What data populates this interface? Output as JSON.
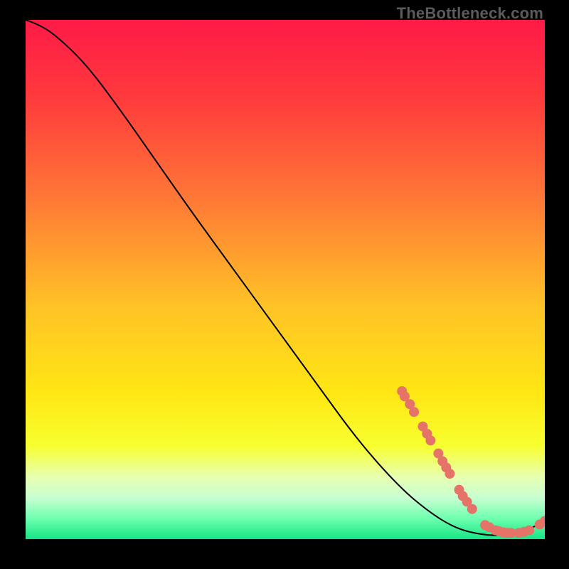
{
  "watermark": "TheBottleneck.com",
  "chart_data": {
    "type": "line",
    "title": "",
    "xlabel": "",
    "ylabel": "",
    "xlim": [
      0,
      100
    ],
    "ylim": [
      0,
      100
    ],
    "grid": false,
    "legend": false,
    "gradient_stops": [
      {
        "offset": 0.0,
        "color": "#ff1a47"
      },
      {
        "offset": 0.15,
        "color": "#ff3a3d"
      },
      {
        "offset": 0.35,
        "color": "#ff7a36"
      },
      {
        "offset": 0.55,
        "color": "#ffc226"
      },
      {
        "offset": 0.72,
        "color": "#ffe714"
      },
      {
        "offset": 0.82,
        "color": "#f7ff2f"
      },
      {
        "offset": 0.88,
        "color": "#e8ffb0"
      },
      {
        "offset": 0.92,
        "color": "#c8ffd2"
      },
      {
        "offset": 0.96,
        "color": "#6effaf"
      },
      {
        "offset": 1.0,
        "color": "#16e585"
      }
    ],
    "series": [
      {
        "name": "bottleneck-curve",
        "stroke": "#000000",
        "points": [
          {
            "x": 0,
            "y": 100
          },
          {
            "x": 3,
            "y": 99
          },
          {
            "x": 7,
            "y": 96
          },
          {
            "x": 12,
            "y": 91
          },
          {
            "x": 18,
            "y": 83
          },
          {
            "x": 25,
            "y": 73
          },
          {
            "x": 32,
            "y": 63
          },
          {
            "x": 40,
            "y": 52
          },
          {
            "x": 48,
            "y": 41
          },
          {
            "x": 56,
            "y": 30
          },
          {
            "x": 64,
            "y": 19
          },
          {
            "x": 72,
            "y": 10
          },
          {
            "x": 78,
            "y": 5
          },
          {
            "x": 83,
            "y": 2
          },
          {
            "x": 88,
            "y": 0.8
          },
          {
            "x": 92,
            "y": 0.7
          },
          {
            "x": 96,
            "y": 1.4
          },
          {
            "x": 100,
            "y": 3.5
          }
        ]
      }
    ],
    "marker_points": {
      "color": "#e57368",
      "radius_screen_px": 7,
      "points": [
        {
          "x": 72.5,
          "y": 28.5
        },
        {
          "x": 73.0,
          "y": 27.5
        },
        {
          "x": 74.0,
          "y": 26.0
        },
        {
          "x": 74.8,
          "y": 24.5
        },
        {
          "x": 76.5,
          "y": 21.7
        },
        {
          "x": 77.3,
          "y": 20.3
        },
        {
          "x": 78.0,
          "y": 19.0
        },
        {
          "x": 79.5,
          "y": 16.5
        },
        {
          "x": 80.3,
          "y": 15.0
        },
        {
          "x": 81.0,
          "y": 13.8
        },
        {
          "x": 81.7,
          "y": 12.6
        },
        {
          "x": 83.5,
          "y": 9.5
        },
        {
          "x": 84.2,
          "y": 8.3
        },
        {
          "x": 85.0,
          "y": 7.2
        },
        {
          "x": 86.0,
          "y": 5.8
        },
        {
          "x": 88.5,
          "y": 2.7
        },
        {
          "x": 89.3,
          "y": 2.3
        },
        {
          "x": 90.5,
          "y": 1.7
        },
        {
          "x": 91.2,
          "y": 1.5
        },
        {
          "x": 92.0,
          "y": 1.3
        },
        {
          "x": 92.8,
          "y": 1.2
        },
        {
          "x": 93.5,
          "y": 1.2
        },
        {
          "x": 95.0,
          "y": 1.2
        },
        {
          "x": 96.0,
          "y": 1.4
        },
        {
          "x": 97.0,
          "y": 1.7
        },
        {
          "x": 99.0,
          "y": 2.8
        },
        {
          "x": 100.0,
          "y": 3.5
        }
      ]
    }
  }
}
